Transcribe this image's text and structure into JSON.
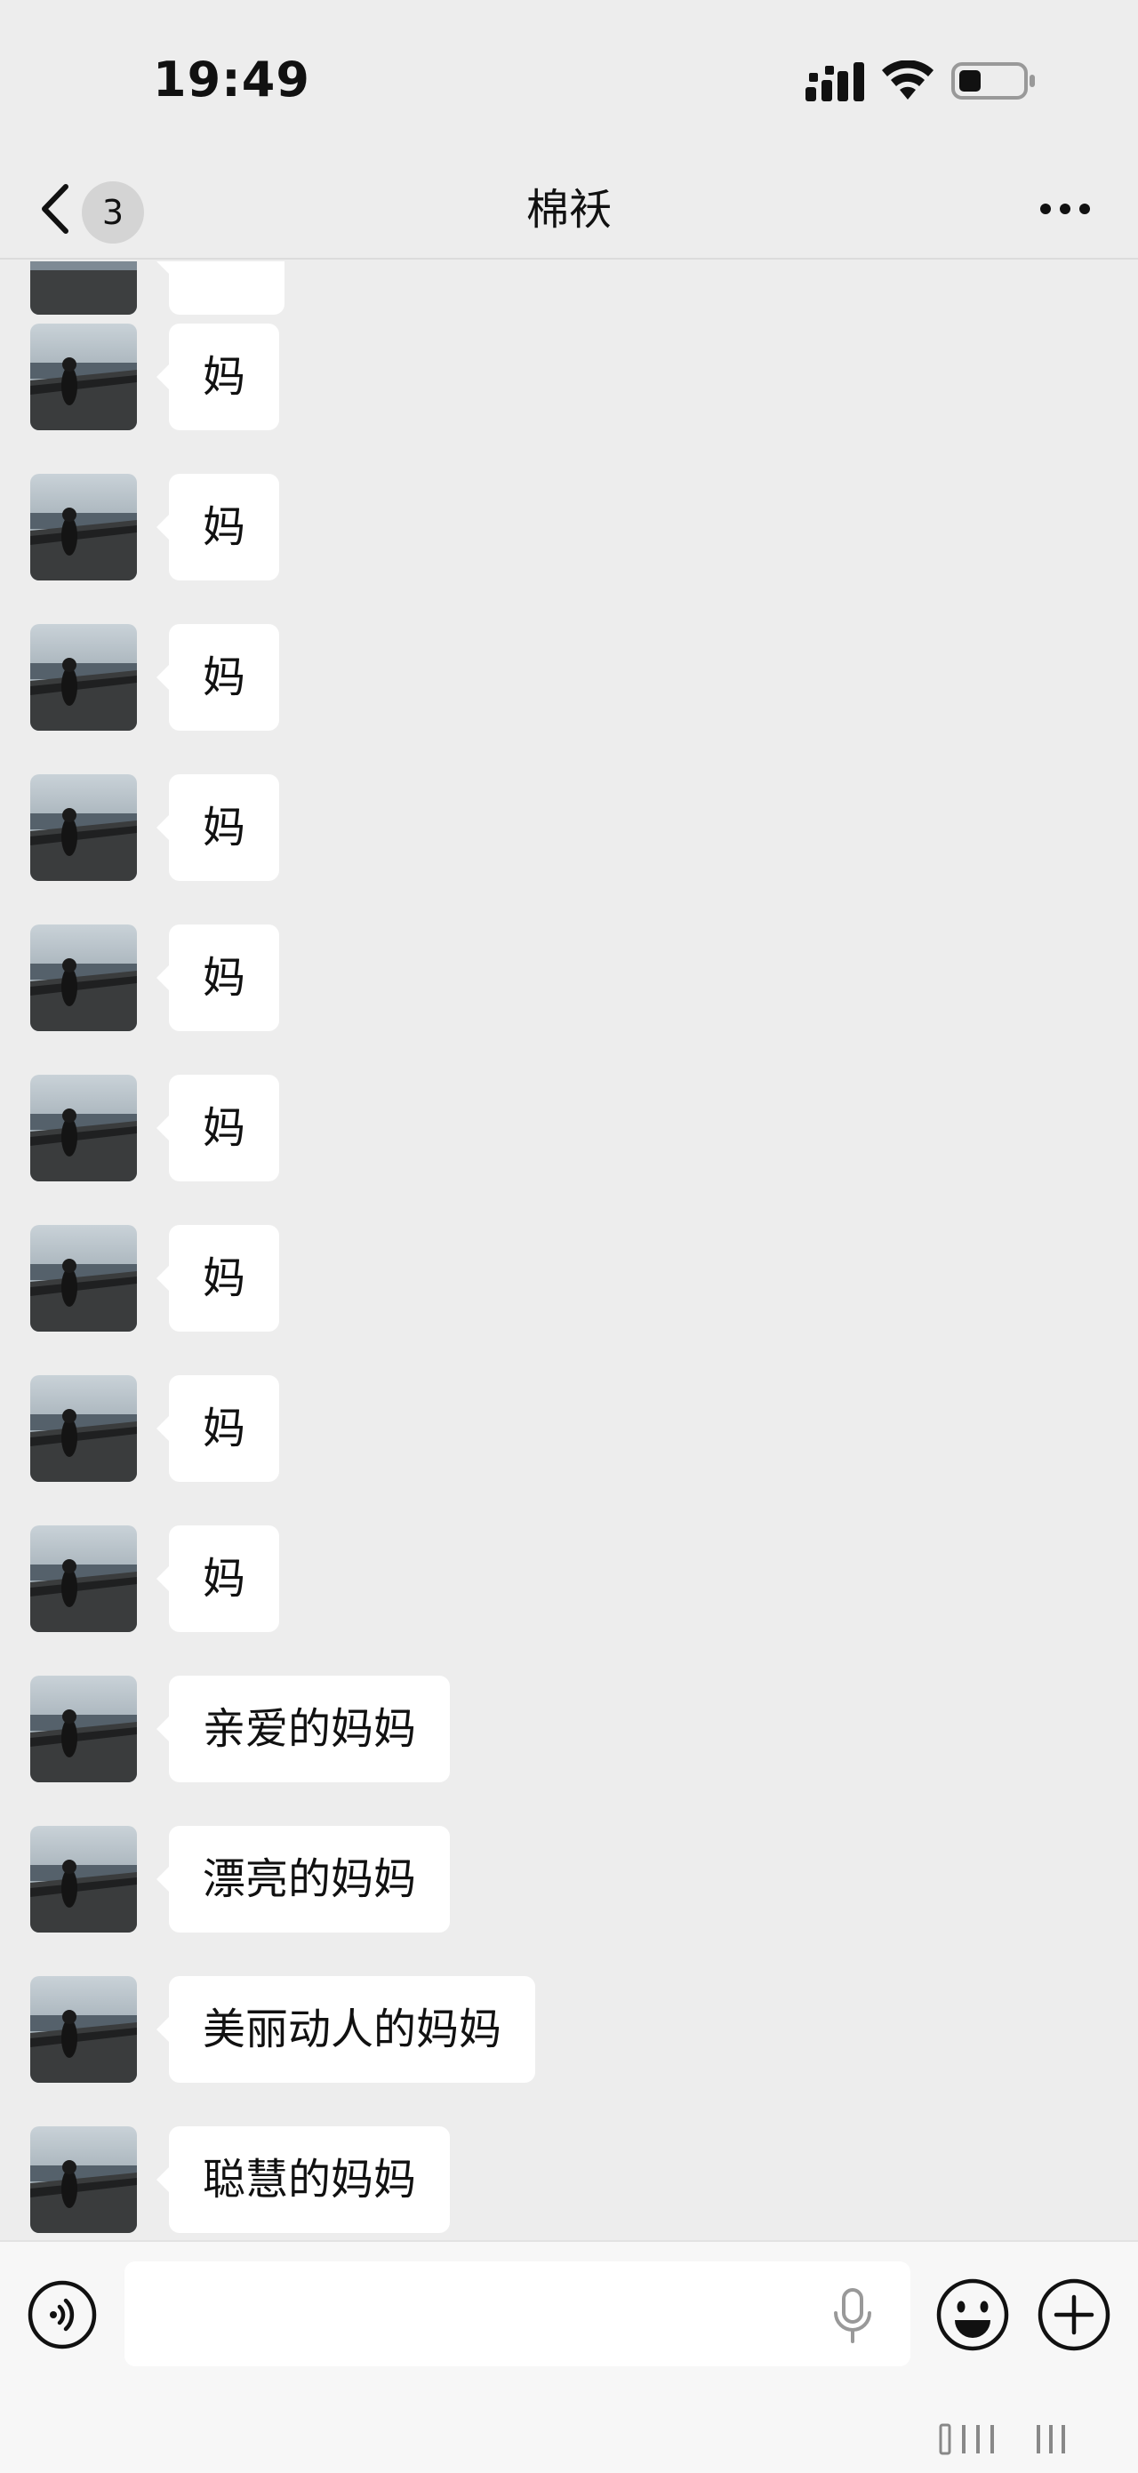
{
  "status_bar": {
    "time": "19:49"
  },
  "nav": {
    "unread_count": "3",
    "title": "棉袄"
  },
  "messages": [
    {
      "text": "妈"
    },
    {
      "text": "妈"
    },
    {
      "text": "妈"
    },
    {
      "text": "妈"
    },
    {
      "text": "妈"
    },
    {
      "text": "妈"
    },
    {
      "text": "妈"
    },
    {
      "text": "妈"
    },
    {
      "text": "妈"
    },
    {
      "text": "亲爱的妈妈"
    },
    {
      "text": "漂亮的妈妈"
    },
    {
      "text": "美丽动人的妈妈"
    },
    {
      "text": "聪慧的妈妈"
    }
  ],
  "input_bar": {
    "value": "",
    "placeholder": ""
  },
  "icons": {
    "back": "chevron-left-icon",
    "more": "more-dots-icon",
    "voice": "voice-wave-icon",
    "mic": "microphone-icon",
    "emoji": "smiley-icon",
    "plus": "plus-circle-icon"
  },
  "colors": {
    "background": "#ededed",
    "bubble": "#ffffff",
    "text": "#111111"
  }
}
